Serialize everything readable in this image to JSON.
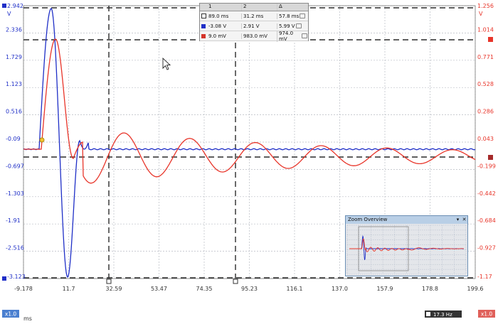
{
  "left_axis": {
    "unit": "V",
    "ticks": [
      "2.942",
      "2.336",
      "1.729",
      "1.123",
      "0.516",
      "-0.09",
      "-0.697",
      "-1.303",
      "-1.91",
      "-2.516",
      "-3.123"
    ]
  },
  "right_axis": {
    "unit": "V",
    "ticks": [
      "1.256",
      "1.014",
      "0.771",
      "0.528",
      "0.286",
      "0.043",
      "-0.199",
      "-0.442",
      "-0.684",
      "-0.927",
      "-1.17"
    ]
  },
  "x_axis": {
    "unit": "ms",
    "ticks": [
      "-9.178",
      "11.7",
      "32.59",
      "53.47",
      "74.35",
      "95.23",
      "116.1",
      "137.0",
      "157.9",
      "178.8",
      "199.6"
    ]
  },
  "scale_left": "x1.0",
  "scale_right": "x1.0",
  "frequency": "17.3 Hz",
  "measurements": {
    "headers": [
      "1",
      "2",
      "Δ"
    ],
    "rows": [
      {
        "color": "#ffffff",
        "v1": "89.0 ms",
        "v2": "31.2 ms",
        "delta": "57.8 ms"
      },
      {
        "color": "#1f2fc7",
        "v1": "-3.08 V",
        "v2": "2.91 V",
        "delta": "5.99 V"
      },
      {
        "color": "#d4342a",
        "v1": "9.0 mV",
        "v2": "983.0 mV",
        "delta": "974.0 mV"
      }
    ]
  },
  "zoom_overview": {
    "title": "Zoom Overview"
  },
  "colors": {
    "channel_a": "#1f2fc7",
    "channel_b": "#e8352a",
    "grid": "#b8bcc4",
    "cursor": "#2a2a2a"
  }
}
